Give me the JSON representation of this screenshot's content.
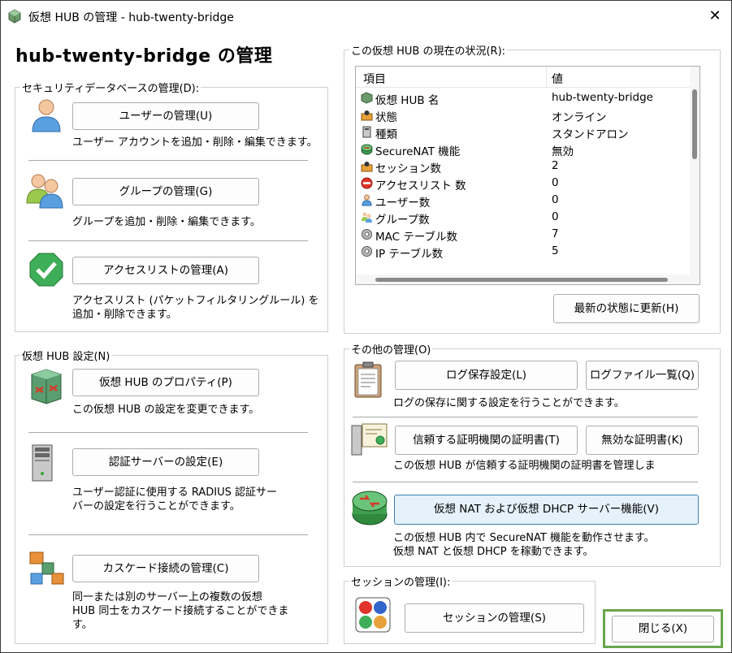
{
  "window": {
    "title": "仮想 HUB の管理 - hub-twenty-bridge",
    "close_glyph": "✕"
  },
  "heading": "hub-twenty-bridge の管理",
  "security_db": {
    "label": "セキュリティデータベースの管理(D):",
    "users_button": "ユーザーの管理(U)",
    "users_desc": "ユーザー アカウントを追加・削除・編集できます。",
    "groups_button": "グループの管理(G)",
    "groups_desc": "グループを追加・削除・編集できます。",
    "acl_button": "アクセスリストの管理(A)",
    "acl_desc_1": "アクセスリスト (パケットフィルタリングルール) を",
    "acl_desc_2": "追加・削除できます。"
  },
  "hub_settings": {
    "label": "仮想 HUB 設定(N)",
    "props_button": "仮想 HUB のプロパティ(P)",
    "props_desc": "この仮想 HUB の設定を変更できます。",
    "auth_button": "認証サーバーの設定(E)",
    "auth_desc_1": "ユーザー認証に使用する RADIUS 認証サー",
    "auth_desc_2": "バーの設定を行うことができます。",
    "cascade_button": "カスケード接続の管理(C)",
    "cascade_desc_1": "同一または別のサーバー上の複数の仮想",
    "cascade_desc_2": "HUB 同士をカスケード接続することができま",
    "cascade_desc_3": "す。"
  },
  "status": {
    "label": "この仮想 HUB の現在の状況(R):",
    "col_item": "項目",
    "col_value": "値",
    "rows": [
      {
        "icon": "hub-icon",
        "name": "仮想 HUB 名",
        "value": "hub-twenty-bridge"
      },
      {
        "icon": "status-icon",
        "name": "状態",
        "value": "オンライン"
      },
      {
        "icon": "server-icon",
        "name": "種類",
        "value": "スタンドアロン"
      },
      {
        "icon": "router-icon",
        "name": "SecureNAT 機能",
        "value": "無効"
      },
      {
        "icon": "session-icon",
        "name": "セッション数",
        "value": "2"
      },
      {
        "icon": "deny-icon",
        "name": "アクセスリスト 数",
        "value": "0"
      },
      {
        "icon": "user-icon",
        "name": "ユーザー数",
        "value": "0"
      },
      {
        "icon": "group-icon",
        "name": "グループ数",
        "value": "0"
      },
      {
        "icon": "gear-icon",
        "name": "MAC テーブル数",
        "value": "7"
      },
      {
        "icon": "gear-icon",
        "name": "IP テーブル数",
        "value": "5"
      }
    ],
    "refresh_button": "最新の状態に更新(H)"
  },
  "other": {
    "label": "その他の管理(O)",
    "log_button": "ログ保存設定(L)",
    "logfiles_button": "ログファイル一覧(Q)",
    "log_desc": "ログの保存に関する設定を行うことができます。",
    "ca_button": "信頼する証明機関の証明書(T)",
    "crl_button": "無効な証明書(K)",
    "ca_desc": "この仮想 HUB が信頼する証明機関の証明書を管理しま",
    "nat_button": "仮想 NAT および仮想 DHCP サーバー機能(V)",
    "nat_desc_1": "この仮想 HUB 内で SecureNAT 機能を動作させます。",
    "nat_desc_2": "仮想 NAT と仮想 DHCP を稼動できます。"
  },
  "sessions": {
    "label": "セッションの管理(I):",
    "button": "セッションの管理(S)"
  },
  "close_button": "閉じる(X)",
  "colors": {
    "highlight_border": "#6aa64b",
    "selected_button_bg": "#e5f1fb"
  }
}
